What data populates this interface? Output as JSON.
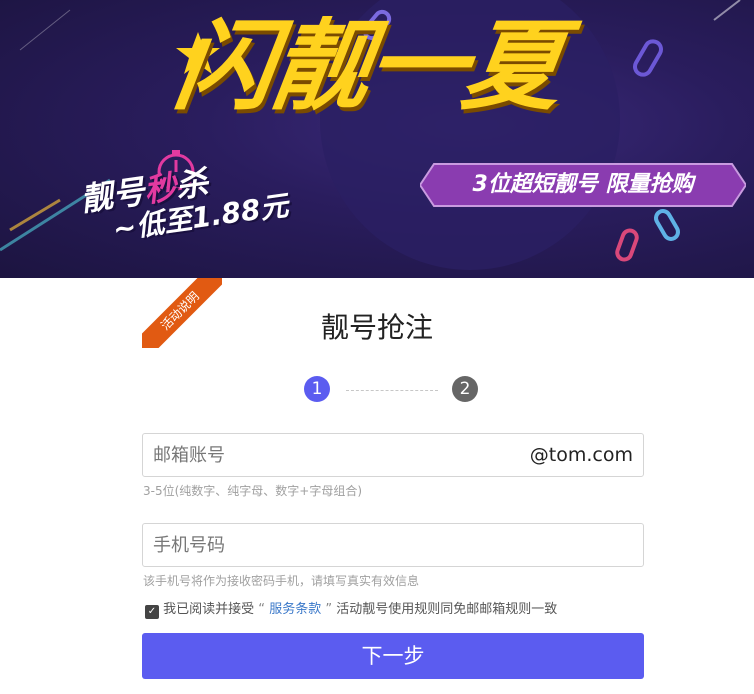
{
  "banner": {
    "title": "闪靓一夏",
    "promo": "3位超短靓号 限量抢购",
    "sec_kill_a": "靓号",
    "sec_kill_b": "秒",
    "sec_kill_c": "杀",
    "price_line": "~低至1.88元"
  },
  "ribbon": {
    "label": "活动说明"
  },
  "page": {
    "title": "靓号抢注"
  },
  "steps": [
    {
      "num": "1",
      "active": true
    },
    {
      "num": "2",
      "active": false
    }
  ],
  "email": {
    "placeholder": "邮箱账号",
    "suffix": "@tom.com",
    "hint": "3-5位(纯数字、纯字母、数字+字母组合)"
  },
  "phone": {
    "placeholder": "手机号码",
    "hint": "该手机号将作为接收密码手机，请填写真实有效信息"
  },
  "agreement": {
    "checked": true,
    "prefix": "我已阅读并接受",
    "open_quote": "“",
    "link": "服务条款",
    "close_quote": "”",
    "suffix": "活动靓号使用规则同免邮邮箱规则一致"
  },
  "next_button": "下一步",
  "colors": {
    "accent": "#5b5cf0",
    "ribbon": "#e15a12",
    "banner_title": "#ffd21e",
    "promo": "#8a3cb0"
  }
}
